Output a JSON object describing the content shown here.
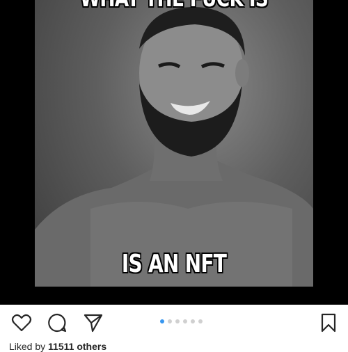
{
  "post": {
    "caption_top": "WHAT THE FUCK IS",
    "caption_bottom": "IS AN NFT"
  },
  "actions": {
    "like_icon": "heart-outline-icon",
    "comment_icon": "comment-bubble-icon",
    "share_icon": "paper-plane-icon",
    "save_icon": "bookmark-outline-icon"
  },
  "carousel": {
    "total": 6,
    "active_index": 0,
    "active_color": "#3897f0",
    "inactive_color": "#d0d0d0"
  },
  "likes": {
    "prefix": "Liked by ",
    "count": "11511 others"
  }
}
